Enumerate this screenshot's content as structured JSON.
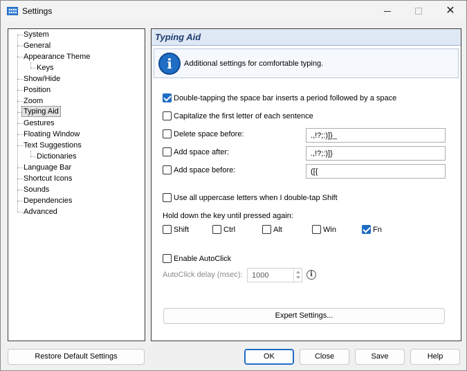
{
  "window": {
    "title": "Settings"
  },
  "tree": {
    "items": [
      {
        "label": "System"
      },
      {
        "label": "General"
      },
      {
        "label": "Appearance Theme"
      },
      {
        "label": "Keys"
      },
      {
        "label": "Show/Hide"
      },
      {
        "label": "Position"
      },
      {
        "label": "Zoom"
      },
      {
        "label": "Typing Aid"
      },
      {
        "label": "Gestures"
      },
      {
        "label": "Floating Window"
      },
      {
        "label": "Text Suggestions"
      },
      {
        "label": "Dictionaries"
      },
      {
        "label": "Language Bar"
      },
      {
        "label": "Shortcut Icons"
      },
      {
        "label": "Sounds"
      },
      {
        "label": "Dependencies"
      },
      {
        "label": "Advanced"
      }
    ],
    "selected": "Typing Aid"
  },
  "panel": {
    "title": "Typing Aid",
    "info_text": "Additional settings for comfortable typing.",
    "double_tap_period": {
      "label": "Double-tapping the space bar inserts a period followed by a space",
      "checked": true
    },
    "capitalize_first": {
      "label": "Capitalize the first letter of each sentence",
      "checked": false
    },
    "delete_space_before": {
      "label": "Delete space before:",
      "checked": false,
      "value": ".,!?;:)]}_"
    },
    "add_space_after": {
      "label": "Add space after:",
      "checked": false,
      "value": ".,!?;:)]}"
    },
    "add_space_before": {
      "label": "Add space before:",
      "checked": false,
      "value": "([{"
    },
    "uppercase_double_tap_shift": {
      "label": "Use all uppercase letters when I double-tap Shift",
      "checked": false
    },
    "hold_key_label": "Hold down the key until pressed again:",
    "hold_keys": [
      {
        "label": "Shift",
        "checked": false
      },
      {
        "label": "Ctrl",
        "checked": false
      },
      {
        "label": "Alt",
        "checked": false
      },
      {
        "label": "Win",
        "checked": false
      },
      {
        "label": "Fn",
        "checked": true
      }
    ],
    "enable_autoclick": {
      "label": "Enable AutoClick",
      "checked": false
    },
    "autoclick_delay_label": "AutoClick delay (msec):",
    "autoclick_delay_value": "1000",
    "expert_settings_label": "Expert Settings..."
  },
  "footer": {
    "restore_label": "Restore Default Settings",
    "ok_label": "OK",
    "close_label": "Close",
    "save_label": "Save",
    "help_label": "Help"
  },
  "colors": {
    "accent": "#1f6dc4",
    "header_bg": "#dfe9f5",
    "header_title": "#1f3d6e"
  }
}
